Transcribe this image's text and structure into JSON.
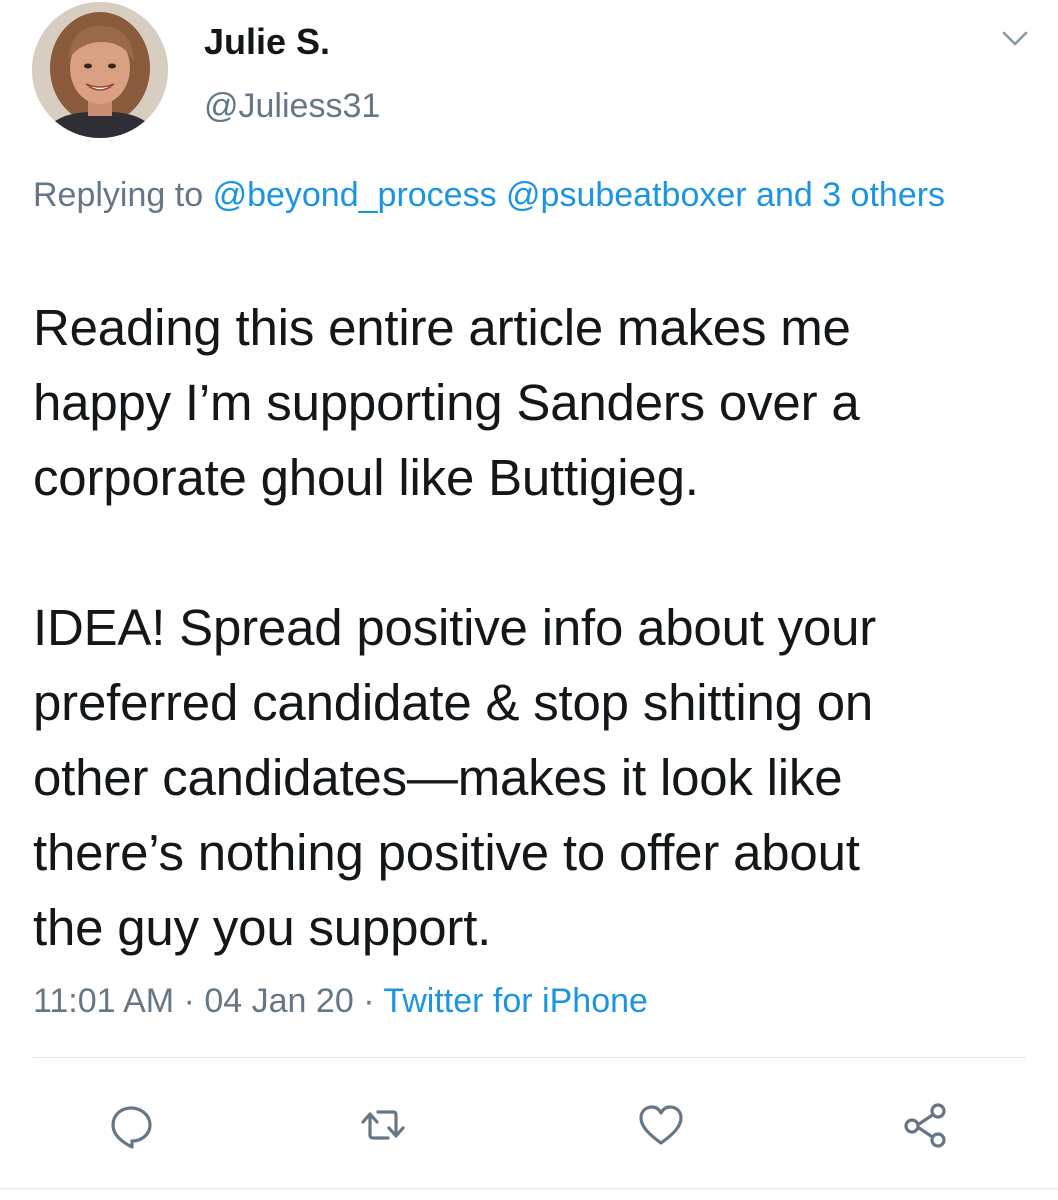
{
  "tweet": {
    "display_name": "Julie S.",
    "handle": "@Juliess31",
    "replying_prefix": "Replying to",
    "reply_mentions": "@beyond_process @psubeatboxer and 3 others",
    "text_paragraph_1": "Reading this entire article makes me\nhappy I’m supporting Sanders over a\ncorporate ghoul like Buttigieg.",
    "text_paragraph_2": "IDEA! Spread positive info about your\npreferred candidate & stop shitting on\nother candidates—makes it look like\nthere’s nothing positive to offer about\nthe guy you support.",
    "time": "11:01 AM",
    "date": "04 Jan 20",
    "separator": "·",
    "source": "Twitter for iPhone"
  },
  "icons": {
    "menu": "chevron-down-icon",
    "reply": "reply-icon",
    "retweet": "retweet-icon",
    "like": "heart-icon",
    "share": "share-icon"
  },
  "colors": {
    "text": "#14171a",
    "secondary": "#657786",
    "link": "#1b95e0",
    "divider": "#e1e8ed"
  }
}
